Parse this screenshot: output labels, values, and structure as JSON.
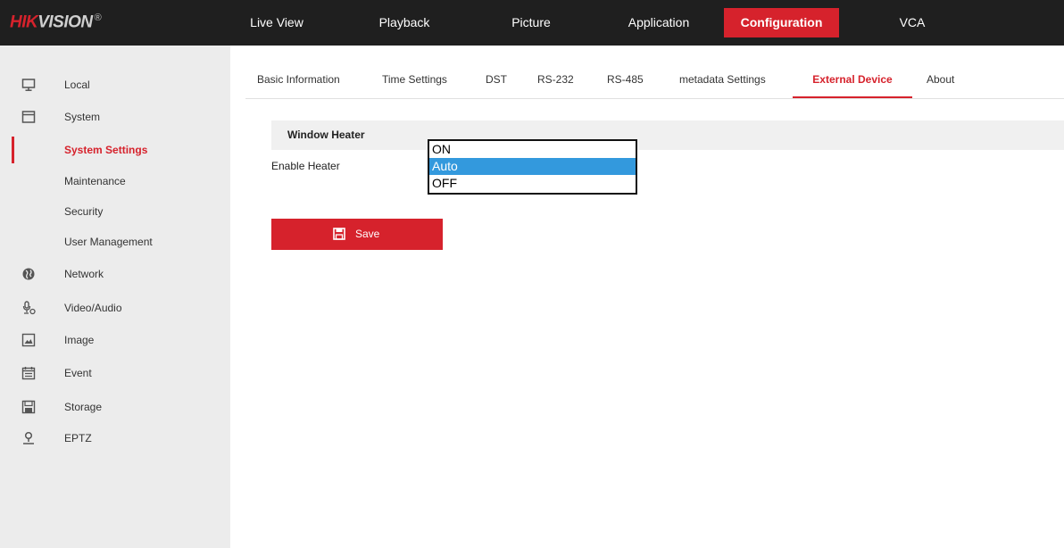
{
  "header": {
    "logo_red": "HIK",
    "logo_grey": "VISION",
    "logo_mark": "®",
    "nav": [
      {
        "label": "Live View"
      },
      {
        "label": "Playback"
      },
      {
        "label": "Picture"
      },
      {
        "label": "Application"
      },
      {
        "label": "Configuration",
        "active": true
      },
      {
        "label": "VCA"
      }
    ]
  },
  "sidebar": {
    "items": [
      {
        "label": "Local",
        "icon": "monitor-icon"
      },
      {
        "label": "System",
        "icon": "system-icon"
      },
      {
        "label": "System Settings",
        "active": true
      },
      {
        "label": "Maintenance"
      },
      {
        "label": "Security"
      },
      {
        "label": "User Management"
      },
      {
        "label": "Network",
        "icon": "globe-icon"
      },
      {
        "label": "Video/Audio",
        "icon": "microphone-icon"
      },
      {
        "label": "Image",
        "icon": "image-icon"
      },
      {
        "label": "Event",
        "icon": "calendar-icon"
      },
      {
        "label": "Storage",
        "icon": "storage-icon"
      },
      {
        "label": "EPTZ",
        "icon": "person-icon"
      }
    ]
  },
  "tabs": [
    {
      "label": "Basic Information"
    },
    {
      "label": "Time Settings"
    },
    {
      "label": "DST"
    },
    {
      "label": "RS-232"
    },
    {
      "label": "RS-485"
    },
    {
      "label": "metadata Settings"
    },
    {
      "label": "External Device",
      "active": true
    },
    {
      "label": "About"
    }
  ],
  "section": {
    "title": "Window Heater",
    "enable_label": "Enable Heater",
    "dropdown_options": [
      "ON",
      "Auto",
      "OFF"
    ],
    "selected": "Auto"
  },
  "save_label": "Save",
  "colors": {
    "accent": "#d6222c",
    "topbar": "#1f1f1f",
    "sidebar": "#ececec",
    "selected_option": "#3399dd"
  }
}
